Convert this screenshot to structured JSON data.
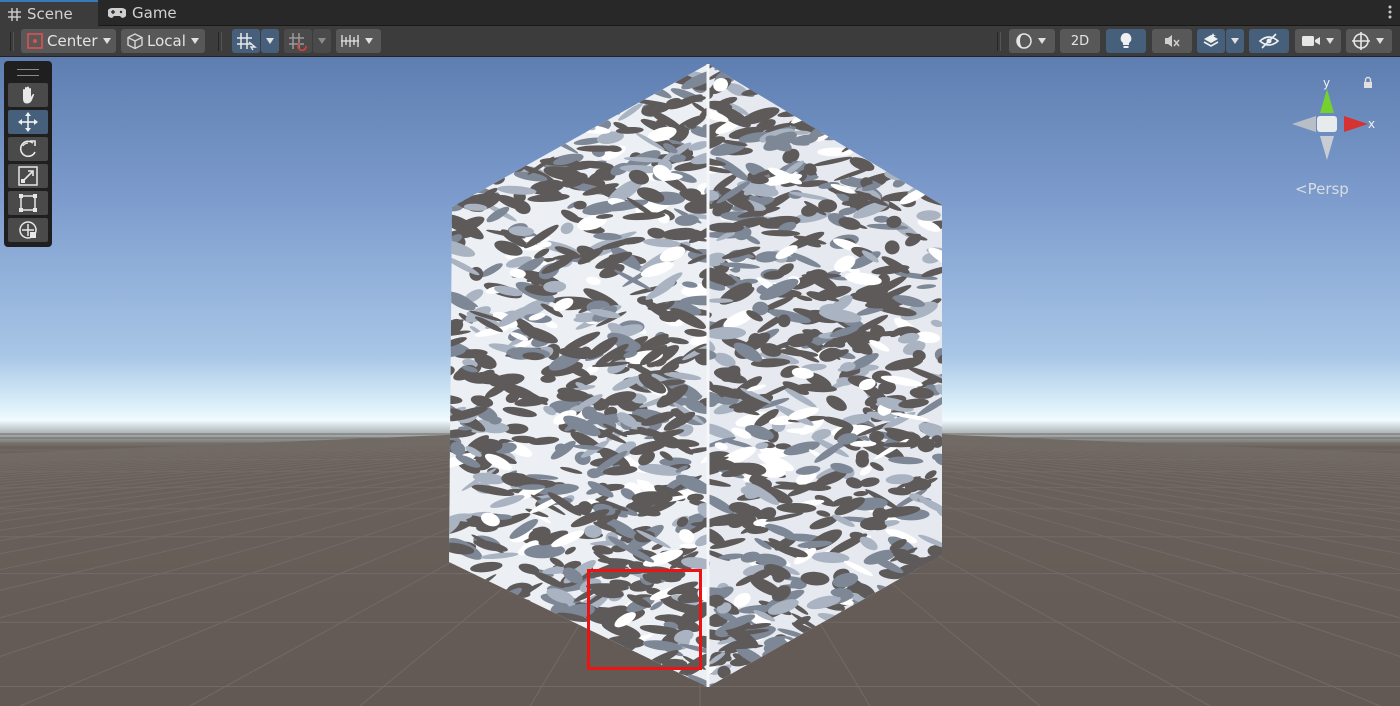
{
  "tabs": [
    {
      "label": "Scene",
      "icon": "grid-icon",
      "active": true
    },
    {
      "label": "Game",
      "icon": "gamepad-icon",
      "active": false
    }
  ],
  "toolbar": {
    "pivot_label": "Center",
    "space_label": "Local",
    "view_2d_label": "2D"
  },
  "tools": [
    "hand-tool",
    "move-tool",
    "rotate-tool",
    "scale-tool",
    "rect-tool",
    "transform-tool"
  ],
  "active_tool": "move-tool",
  "gizmo": {
    "y_label": "y",
    "x_label": "x",
    "projection_label": "Persp"
  },
  "colors": {
    "accent": "#3a79bb",
    "toggle_on": "#46607c",
    "highlight": "#ee1313",
    "axis_x": "#d63232",
    "axis_y": "#75d130"
  }
}
